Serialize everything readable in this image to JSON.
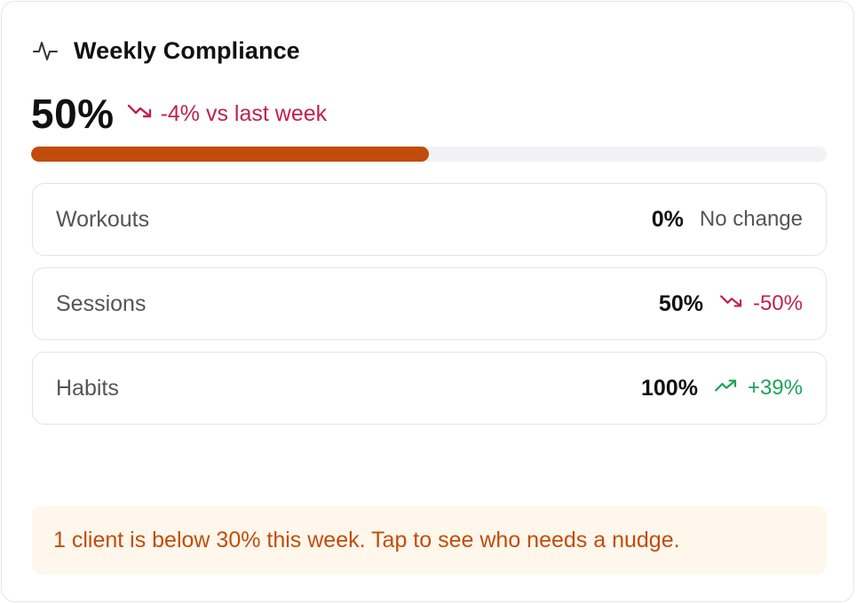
{
  "card": {
    "title": "Weekly Compliance",
    "icon": "activity-icon"
  },
  "summary": {
    "value": "50%",
    "progress_fraction": 0.5,
    "trend": {
      "direction": "down",
      "text": "-4% vs last week"
    }
  },
  "metrics": [
    {
      "label": "Workouts",
      "value": "0%",
      "change": "No change",
      "direction": "neutral"
    },
    {
      "label": "Sessions",
      "value": "50%",
      "change": "-50%",
      "direction": "down"
    },
    {
      "label": "Habits",
      "value": "100%",
      "change": "+39%",
      "direction": "up"
    }
  ],
  "alert": {
    "text": "1 client is below 30% this week. Tap to see who needs a nudge."
  },
  "colors": {
    "accent": "#c24c0c",
    "down": "#c0214d",
    "up": "#1ea35a",
    "alert_bg": "#fff7eb"
  }
}
